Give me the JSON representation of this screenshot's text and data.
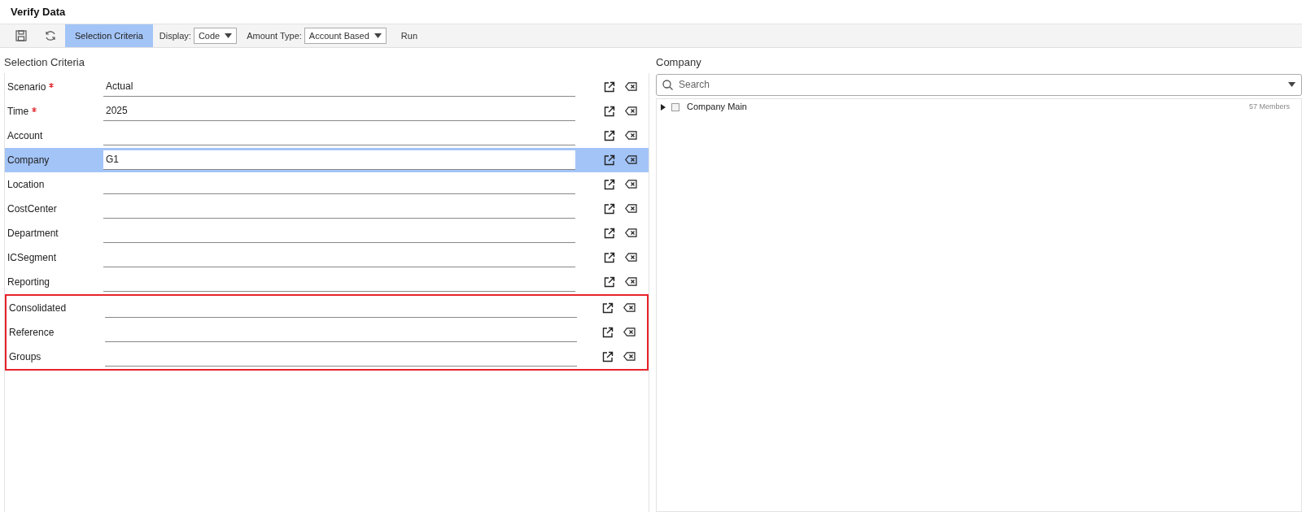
{
  "window": {
    "title": "Verify Data"
  },
  "toolbar": {
    "selection_button": {
      "label": "Selection Criteria",
      "selected": true
    },
    "display": {
      "label": "Display:",
      "value": "Code"
    },
    "amount_type": {
      "label": "Amount Type:",
      "value": "Account Based"
    },
    "run": {
      "label": "Run"
    }
  },
  "selection_criteria": {
    "title": "Selection Criteria",
    "fields": [
      {
        "label": "Scenario",
        "required": true,
        "value": "Actual",
        "selected": false
      },
      {
        "label": "Time",
        "required": true,
        "value": "2025",
        "selected": false
      },
      {
        "label": "Account",
        "required": false,
        "selected": false
      },
      {
        "label": "Company",
        "required": false,
        "value": "G1",
        "selected": true
      },
      {
        "label": "Location",
        "required": false,
        "selected": false
      },
      {
        "label": "CostCenter",
        "required": false,
        "selected": false
      },
      {
        "label": "Department",
        "required": false,
        "selected": false
      },
      {
        "label": "ICSegment",
        "required": false,
        "selected": false
      },
      {
        "label": "Reporting",
        "required": false,
        "selected": false
      }
    ],
    "highlighted_fields": [
      {
        "label": "Consolidated",
        "required": false,
        "selected": false
      },
      {
        "label": "Reference",
        "required": false,
        "selected": false
      },
      {
        "label": "Groups",
        "required": false,
        "selected": false
      }
    ]
  },
  "member_panel": {
    "title": "Company",
    "search": {
      "placeholder": "Search"
    },
    "tree": [
      {
        "label": "Company Main",
        "checked": false,
        "expanded": false,
        "count": "57 Members"
      }
    ]
  }
}
